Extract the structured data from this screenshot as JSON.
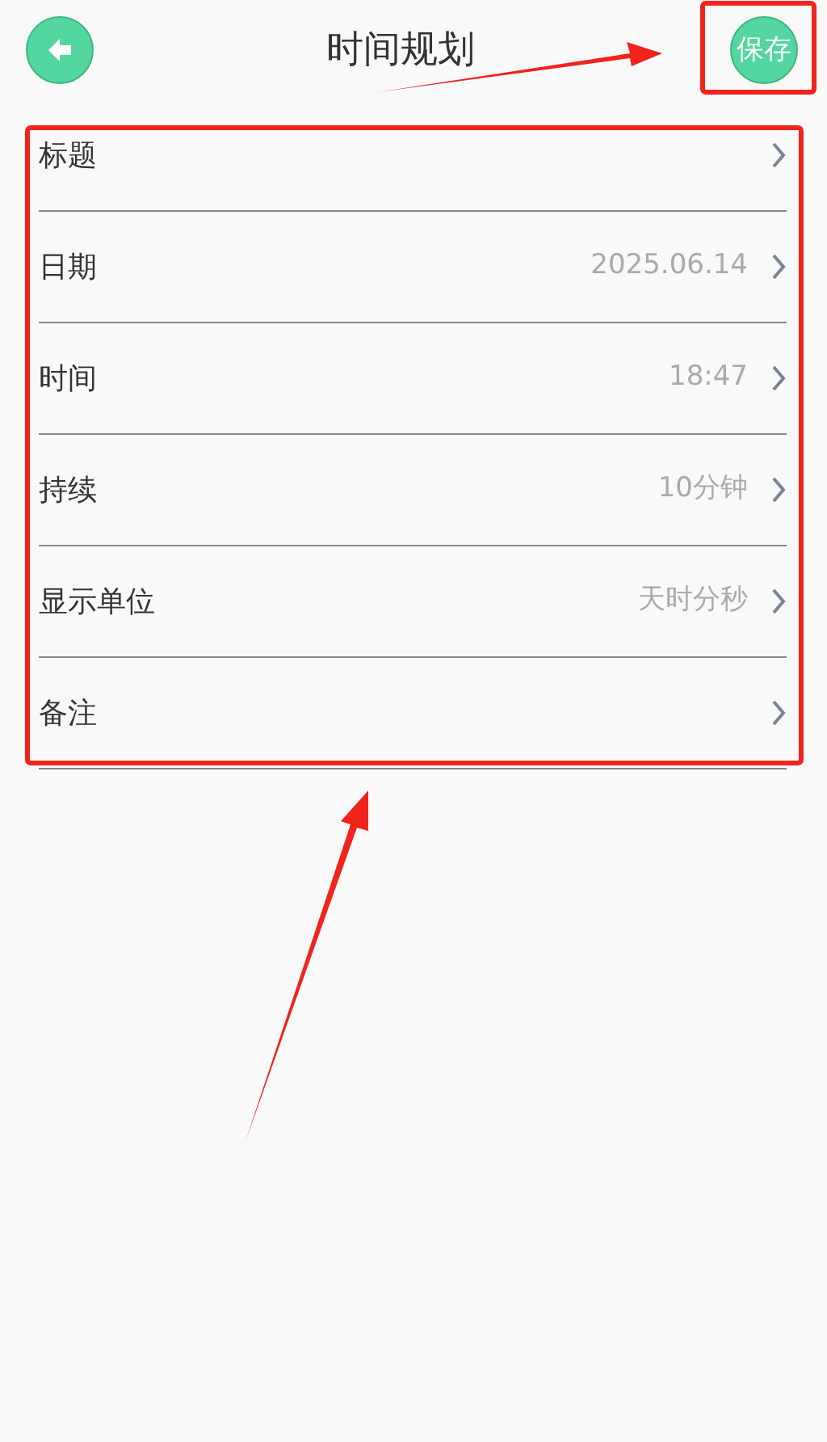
{
  "header": {
    "title": "时间规划",
    "save_button": "保存"
  },
  "rows": [
    {
      "label": "标题"
    },
    {
      "label": "日期",
      "value": "2025.06.14"
    },
    {
      "label": "时间",
      "value": "18:47"
    },
    {
      "label": "持续",
      "value": "10分钟"
    },
    {
      "label": "显示单位",
      "value": "天时分秒"
    },
    {
      "label": "备注"
    }
  ]
}
